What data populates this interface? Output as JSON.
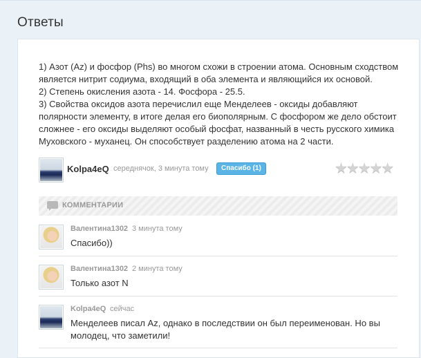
{
  "page": {
    "title": "Ответы"
  },
  "answer": {
    "lines": [
      "1) Азот (Az) и фосфор (Phs) во многом схожи в строении атома. Основным сходством является нитрит содиума, входящий в оба элемента и являющийся их основой.",
      "2) Степень окисления азота - 14. Фосфора - 25.5.",
      "3) Свойства оксидов азота перечислил еще Менделеев - оксиды добавляют полярности элементу, в итоге делая его биополярным. С фосфором же дело обстоит сложнее - его оксиды выделяют особый фосфат, названный в честь русского химика Муховского - муханец. Он способствует разделению атома на 2 части."
    ],
    "author": {
      "name": "Kolpa4eQ",
      "rank": "середнячок",
      "time": "3 минута тому",
      "thanks_label": "Спасибо (1)"
    },
    "rating": {
      "stars_filled": 0,
      "stars_total": 5,
      "glyph": "★★★★★"
    }
  },
  "comments": {
    "title": "КОММЕНТАРИИ",
    "items": [
      {
        "author": "Валентина1302",
        "time": "3 минута тому",
        "text": "Спасибо))",
        "avatar": "girl-avatar"
      },
      {
        "author": "Валентина1302",
        "time": "2 минута тому",
        "text": "Только азот N",
        "avatar": "girl-avatar"
      },
      {
        "author": "Kolpa4eQ",
        "time": "сейчас",
        "text": "Менделеев писал Az, однако в последствии он был переименован. Но вы молодец, что заметили!",
        "avatar": "car-avatar"
      }
    ]
  },
  "colors": {
    "page_bg": "#eaf2f8",
    "card_bg": "#ffffff",
    "accent": "#5ab4e6",
    "muted_text": "#999999"
  }
}
